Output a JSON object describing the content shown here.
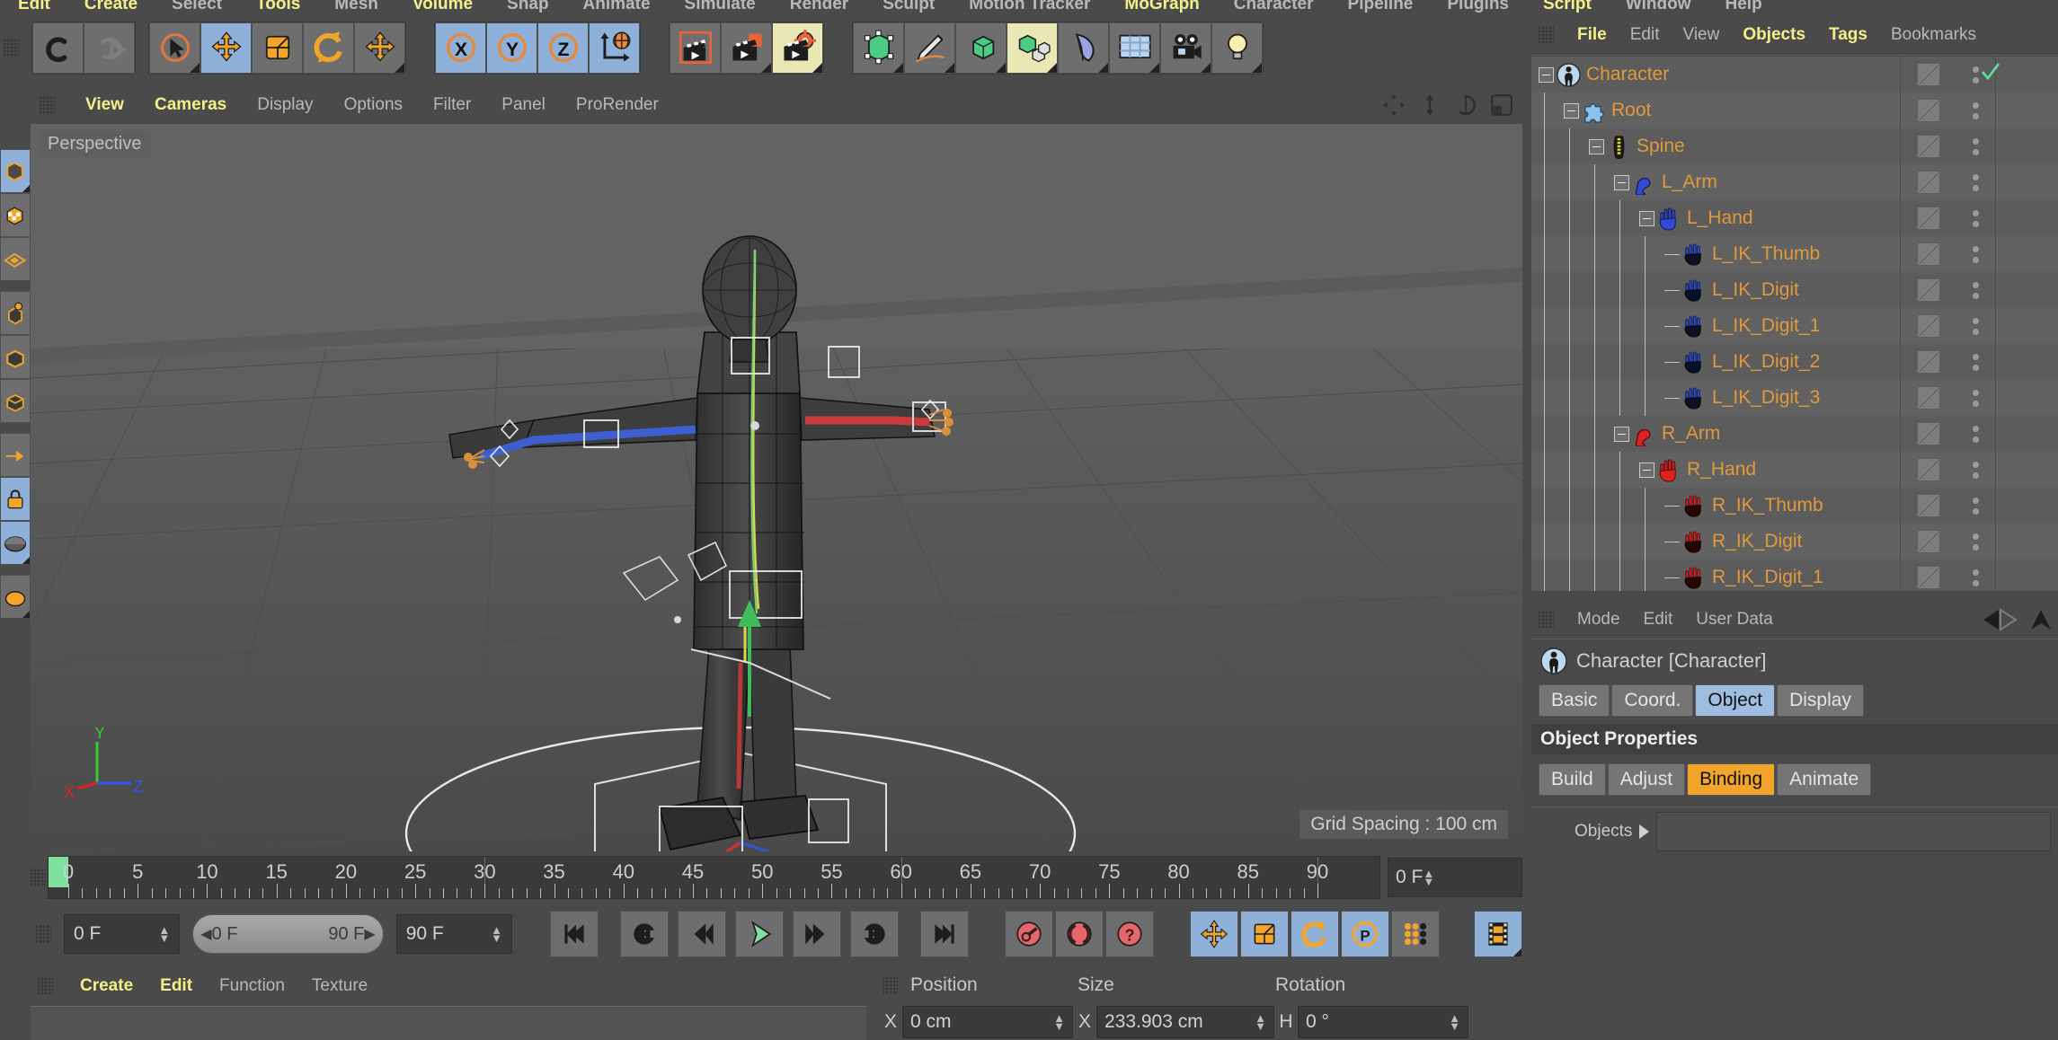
{
  "app": {
    "title": "Cinema 4D"
  },
  "top_menu": {
    "items": [
      {
        "label": "Edit",
        "hl": true
      },
      {
        "label": "Create",
        "hl": true
      },
      {
        "label": "Select",
        "hl": false
      },
      {
        "label": "Tools",
        "hl": true
      },
      {
        "label": "Mesh",
        "hl": false
      },
      {
        "label": "Volume",
        "hl": true
      },
      {
        "label": "Snap",
        "hl": false
      },
      {
        "label": "Animate",
        "hl": false
      },
      {
        "label": "Simulate",
        "hl": false
      },
      {
        "label": "Render",
        "hl": false
      },
      {
        "label": "Sculpt",
        "hl": false
      },
      {
        "label": "Motion Tracker",
        "hl": false
      },
      {
        "label": "MoGraph",
        "hl": true
      },
      {
        "label": "Character",
        "hl": false
      },
      {
        "label": "Pipeline",
        "hl": false
      },
      {
        "label": "Plugins",
        "hl": false
      },
      {
        "label": "Script",
        "hl": true
      },
      {
        "label": "Window",
        "hl": false
      },
      {
        "label": "Help",
        "hl": false
      }
    ]
  },
  "toolbar": {
    "groups": [
      {
        "name": "undo-redo",
        "buttons": [
          {
            "icon": "undo-icon",
            "label": "Undo",
            "selected": false,
            "corner": false
          },
          {
            "icon": "redo-icon",
            "label": "Redo",
            "selected": false,
            "corner": false
          }
        ]
      },
      {
        "name": "transform-tools",
        "buttons": [
          {
            "icon": "select-arrow-icon",
            "label": "Live Selection",
            "selected": false,
            "corner": true
          },
          {
            "icon": "move-icon",
            "label": "Move",
            "selected": true,
            "corner": false
          },
          {
            "icon": "scale-icon",
            "label": "Scale",
            "selected": false,
            "corner": false
          },
          {
            "icon": "rotate-icon",
            "label": "Rotate",
            "selected": false,
            "corner": false
          },
          {
            "icon": "move-icon",
            "label": "Move Tool",
            "selected": false,
            "corner": true
          }
        ]
      },
      {
        "name": "axis-locks",
        "buttons": [
          {
            "icon": "axis-x-icon",
            "label": "X Axis",
            "selected": true,
            "corner": false
          },
          {
            "icon": "axis-y-icon",
            "label": "Y Axis",
            "selected": true,
            "corner": false
          },
          {
            "icon": "axis-z-icon",
            "label": "Z Axis",
            "selected": true,
            "corner": false
          },
          {
            "icon": "world-coordinates-icon",
            "label": "World / Object Coordinates",
            "selected": true,
            "corner": false
          }
        ]
      },
      {
        "name": "render-tools",
        "buttons": [
          {
            "icon": "render-view-icon",
            "label": "Render View",
            "selected": false,
            "corner": false
          },
          {
            "icon": "render-region-icon",
            "label": "Render to Picture Viewer",
            "selected": false,
            "corner": true
          },
          {
            "icon": "render-settings-icon",
            "label": "Edit Render Settings",
            "selected": false,
            "corner": true,
            "yellow": true
          }
        ]
      },
      {
        "name": "primitives",
        "buttons": [
          {
            "icon": "cube-primitive-icon",
            "label": "Cube",
            "selected": false,
            "corner": true
          },
          {
            "icon": "spline-pen-icon",
            "label": "Pen",
            "selected": false,
            "corner": true
          },
          {
            "icon": "nurbs-icon",
            "label": "Subdivision Surface",
            "selected": false,
            "corner": true
          },
          {
            "icon": "array-icon",
            "label": "Array / MoGraph",
            "selected": false,
            "corner": true,
            "yellow": true
          },
          {
            "icon": "bend-deformer-icon",
            "label": "Bend Deformer",
            "selected": false,
            "corner": true
          },
          {
            "icon": "floor-icon",
            "label": "Floor / Environment",
            "selected": false,
            "corner": true
          },
          {
            "icon": "camera-icon",
            "label": "Camera",
            "selected": false,
            "corner": true
          },
          {
            "icon": "light-icon",
            "label": "Light",
            "selected": false,
            "corner": true
          }
        ]
      }
    ]
  },
  "left_toolbar": {
    "buttons": [
      {
        "icon": "model-mode-icon",
        "label": "Model Mode",
        "selected": true,
        "corner": true
      },
      {
        "icon": "texture-mode-icon",
        "label": "Texture Mode",
        "selected": false,
        "corner": false
      },
      {
        "icon": "workplane-icon",
        "label": "Workplane",
        "selected": false,
        "corner": false
      },
      {
        "icon": "point-mode-icon",
        "label": "Points Mode",
        "selected": false,
        "corner": false,
        "gap": true
      },
      {
        "icon": "edge-mode-icon",
        "label": "Edges Mode",
        "selected": false,
        "corner": false
      },
      {
        "icon": "polygon-mode-icon",
        "label": "Polygons Mode",
        "selected": false,
        "corner": false
      },
      {
        "icon": "enable-axis-icon",
        "label": "Enable Axis Modification",
        "selected": false,
        "corner": false,
        "gap": true
      },
      {
        "icon": "viewport-lock-icon",
        "label": "Lock Workplane",
        "selected": true,
        "corner": false
      },
      {
        "icon": "planar-workplane-icon",
        "label": "Planar Workplane",
        "selected": true,
        "corner": true
      },
      {
        "icon": "quantize-icon",
        "label": "Quantize",
        "selected": false,
        "corner": true,
        "gap": true
      }
    ]
  },
  "viewport": {
    "menu": [
      "View",
      "Cameras",
      "Display",
      "Options",
      "Filter",
      "Panel",
      "ProRender"
    ],
    "menu_highlight": [
      "View",
      "Cameras"
    ],
    "corner_icons": [
      "pan-camera-icon",
      "dolly-camera-icon",
      "rotate-camera-icon",
      "maximize-viewport-icon"
    ],
    "label": "Perspective",
    "grid_spacing": "Grid Spacing : 100 cm",
    "axis_gizmo": {
      "x": "X",
      "y": "Y",
      "z": "Z"
    }
  },
  "timeline": {
    "ticks": [
      0,
      5,
      10,
      15,
      20,
      25,
      30,
      35,
      40,
      45,
      50,
      55,
      60,
      65,
      70,
      75,
      80,
      85,
      90
    ],
    "range_start": 0,
    "range_end": 90,
    "current_frame_field": "0 F"
  },
  "transport": {
    "current_frame": "0 F",
    "preview_min": "0 F",
    "preview_max": "90 F",
    "max_frame": "90 F",
    "buttons": [
      {
        "icon": "go-to-start-icon",
        "label": "Go to Start",
        "selected": false
      },
      {
        "icon": "prev-key-icon",
        "label": "Go to Previous Key",
        "selected": false
      },
      {
        "icon": "prev-frame-icon",
        "label": "Go to Previous Frame",
        "selected": false
      },
      {
        "icon": "play-icon",
        "label": "Play Forwards",
        "selected": false
      },
      {
        "icon": "next-frame-icon",
        "label": "Go to Next Frame",
        "selected": false
      },
      {
        "icon": "next-key-icon",
        "label": "Go to Next Key",
        "selected": false
      },
      {
        "icon": "go-to-end-icon",
        "label": "Go to End",
        "selected": false
      }
    ],
    "record_buttons": [
      {
        "icon": "record-key-icon",
        "label": "Record Active Objects",
        "selected": false
      },
      {
        "icon": "autokey-icon",
        "label": "Autokeying",
        "selected": false
      },
      {
        "icon": "keyframe-help-icon",
        "label": "Keyframe Selection",
        "selected": false
      }
    ],
    "key_toggles": [
      {
        "icon": "key-position-icon",
        "label": "Position",
        "selected": true
      },
      {
        "icon": "key-scale-icon",
        "label": "Scale",
        "selected": true
      },
      {
        "icon": "key-rotation-icon",
        "label": "Rotation",
        "selected": true
      },
      {
        "icon": "key-pla-icon",
        "label": "Point Level Animation",
        "selected": true
      },
      {
        "icon": "key-params-icon",
        "label": "Parameter",
        "selected": false
      }
    ],
    "timeline_button": {
      "icon": "timeline-icon",
      "label": "Timeline",
      "selected": true
    }
  },
  "material_manager": {
    "menu": [
      "Create",
      "Edit",
      "Function",
      "Texture"
    ],
    "menu_highlight": [
      "Create",
      "Edit"
    ]
  },
  "coordinates": {
    "headers": [
      "Position",
      "Size",
      "Rotation"
    ],
    "rows": [
      {
        "axis": "X",
        "position": "0 cm",
        "size_axis": "X",
        "size": "233.903 cm",
        "rot_axis": "H",
        "rotation": "0 °"
      }
    ]
  },
  "object_manager": {
    "menu": [
      "File",
      "Edit",
      "View",
      "Objects",
      "Tags",
      "Bookmarks"
    ],
    "menu_highlight": [
      "File",
      "Objects",
      "Tags"
    ],
    "tree": [
      {
        "label": "Character",
        "depth": 0,
        "icon": "character-object-icon",
        "expander": true,
        "check": true
      },
      {
        "label": "Root",
        "depth": 1,
        "icon": "puzzle-piece-icon",
        "expander": true,
        "check": false
      },
      {
        "label": "Spine",
        "depth": 2,
        "icon": "spine-icon",
        "expander": true,
        "check": false
      },
      {
        "label": "L_Arm",
        "depth": 3,
        "icon": "blue-arm-icon",
        "expander": true,
        "check": false
      },
      {
        "label": "L_Hand",
        "depth": 4,
        "icon": "blue-hand-icon",
        "expander": true,
        "check": false
      },
      {
        "label": "L_IK_Thumb",
        "depth": 5,
        "icon": "blue-ik-hand-icon",
        "expander": false,
        "check": false
      },
      {
        "label": "L_IK_Digit",
        "depth": 5,
        "icon": "blue-ik-hand-icon",
        "expander": false,
        "check": false
      },
      {
        "label": "L_IK_Digit_1",
        "depth": 5,
        "icon": "blue-ik-hand-icon",
        "expander": false,
        "check": false
      },
      {
        "label": "L_IK_Digit_2",
        "depth": 5,
        "icon": "blue-ik-hand-icon",
        "expander": false,
        "check": false
      },
      {
        "label": "L_IK_Digit_3",
        "depth": 5,
        "icon": "blue-ik-hand-icon",
        "expander": false,
        "check": false
      },
      {
        "label": "R_Arm",
        "depth": 3,
        "icon": "red-arm-icon",
        "expander": true,
        "check": false
      },
      {
        "label": "R_Hand",
        "depth": 4,
        "icon": "red-hand-icon",
        "expander": true,
        "check": false
      },
      {
        "label": "R_IK_Thumb",
        "depth": 5,
        "icon": "red-ik-hand-icon",
        "expander": false,
        "check": false
      },
      {
        "label": "R_IK_Digit",
        "depth": 5,
        "icon": "red-ik-hand-icon",
        "expander": false,
        "check": false
      },
      {
        "label": "R_IK_Digit_1",
        "depth": 5,
        "icon": "red-ik-hand-icon",
        "expander": false,
        "check": false
      }
    ]
  },
  "attribute_manager": {
    "menu": [
      "Mode",
      "Edit",
      "User Data"
    ],
    "nav_icons": [
      "back-arrow-icon",
      "forward-arrow-icon",
      "up-arrow-icon"
    ],
    "object_title": "Character [Character]",
    "object_icon": "character-object-icon",
    "tabs": [
      {
        "label": "Basic",
        "state": "normal"
      },
      {
        "label": "Coord.",
        "state": "normal"
      },
      {
        "label": "Object",
        "state": "selected"
      },
      {
        "label": "Display",
        "state": "normal"
      }
    ],
    "section_title": "Object Properties",
    "sub_tabs": [
      {
        "label": "Build",
        "state": "normal"
      },
      {
        "label": "Adjust",
        "state": "normal"
      },
      {
        "label": "Binding",
        "state": "orange"
      },
      {
        "label": "Animate",
        "state": "normal"
      }
    ],
    "fields": [
      {
        "label": "Objects",
        "value": ""
      }
    ]
  },
  "colors": {
    "accent_orange": "#e09a3c",
    "accent_yellow": "#f2f08a",
    "selected_blue": "#8fb0d8",
    "binding_orange": "#f2a42b",
    "panel_bg": "#4a4a4a",
    "field_bg": "#3a3a3a",
    "play_green": "#7fe0a0",
    "record_red": "#e4676c"
  }
}
